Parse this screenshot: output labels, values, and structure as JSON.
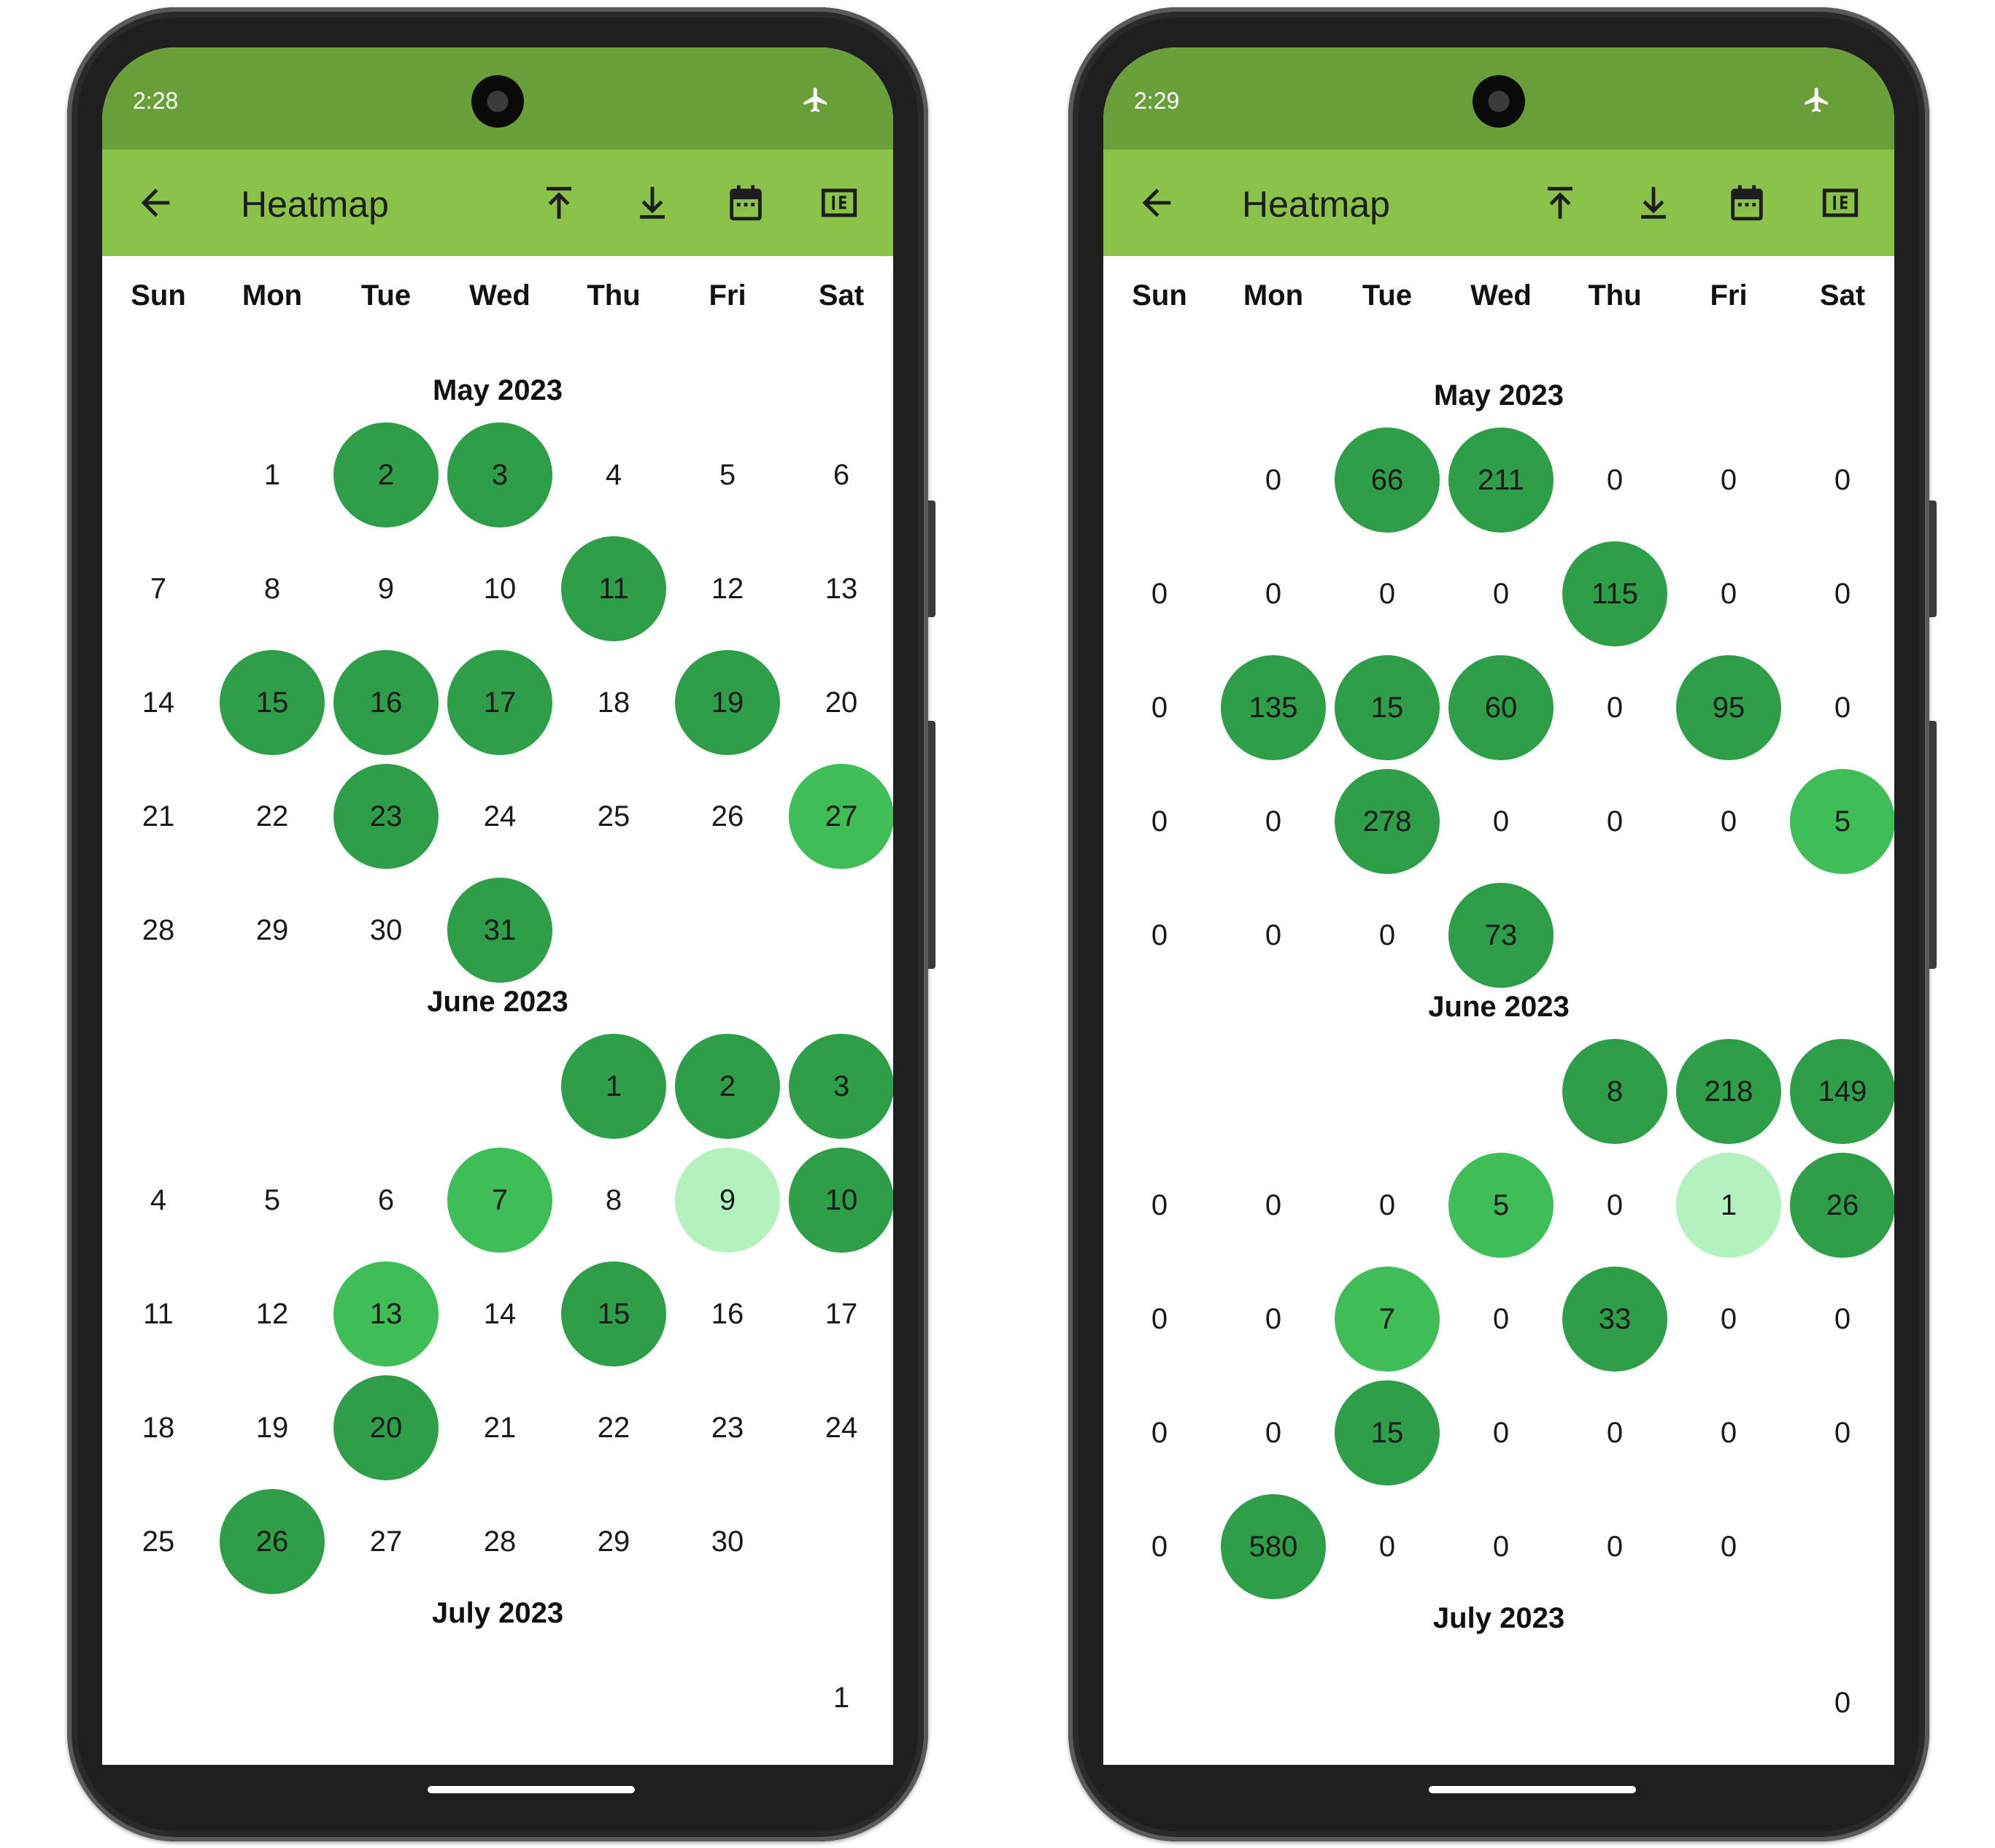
{
  "weekdays": [
    "Sun",
    "Mon",
    "Tue",
    "Wed",
    "Thu",
    "Fri",
    "Sat"
  ],
  "icons": {
    "plane": "airplane-mode-icon",
    "back": "arrow-back-icon",
    "scroll_top": "scroll-to-top-icon",
    "scroll_bottom": "scroll-to-bottom-icon",
    "calendar": "calendar-icon",
    "numbers": "show-numbers-icon"
  },
  "colors": {
    "status_bar": "#689f38",
    "toolbar": "#8bc34a",
    "level_high": "#2e9e48",
    "level_mid": "#3fbe58",
    "level_low": "#b3f2bf"
  },
  "screens": [
    {
      "status_time": "2:28",
      "title": "Heatmap",
      "months": [
        {
          "name": "May 2023",
          "start": 1,
          "labels": [
            "1",
            "2",
            "3",
            "4",
            "5",
            "6",
            "7",
            "8",
            "9",
            "10",
            "11",
            "12",
            "13",
            "14",
            "15",
            "16",
            "17",
            "18",
            "19",
            "20",
            "21",
            "22",
            "23",
            "24",
            "25",
            "26",
            "27",
            "28",
            "29",
            "30",
            "31"
          ],
          "levels": [
            0,
            3,
            3,
            0,
            0,
            0,
            0,
            0,
            0,
            0,
            3,
            0,
            0,
            0,
            3,
            3,
            3,
            0,
            3,
            0,
            0,
            0,
            3,
            0,
            0,
            0,
            2,
            0,
            0,
            0,
            3
          ]
        },
        {
          "name": "June 2023",
          "start": 4,
          "labels": [
            "1",
            "2",
            "3",
            "4",
            "5",
            "6",
            "7",
            "8",
            "9",
            "10",
            "11",
            "12",
            "13",
            "14",
            "15",
            "16",
            "17",
            "18",
            "19",
            "20",
            "21",
            "22",
            "23",
            "24",
            "25",
            "26",
            "27",
            "28",
            "29",
            "30"
          ],
          "levels": [
            3,
            3,
            3,
            0,
            0,
            0,
            2,
            0,
            1,
            3,
            0,
            0,
            2,
            0,
            3,
            0,
            0,
            0,
            0,
            3,
            0,
            0,
            0,
            0,
            0,
            3,
            0,
            0,
            0,
            0
          ]
        },
        {
          "name": "July 2023",
          "start": 6,
          "labels": [
            "1"
          ],
          "levels": [
            0
          ]
        }
      ]
    },
    {
      "status_time": "2:29",
      "title": "Heatmap",
      "months": [
        {
          "name": "May 2023",
          "start": 1,
          "labels": [
            "0",
            "66",
            "211",
            "0",
            "0",
            "0",
            "0",
            "0",
            "0",
            "0",
            "115",
            "0",
            "0",
            "0",
            "135",
            "15",
            "60",
            "0",
            "95",
            "0",
            "0",
            "0",
            "278",
            "0",
            "0",
            "0",
            "5",
            "0",
            "0",
            "0",
            "73"
          ],
          "levels": [
            0,
            3,
            3,
            0,
            0,
            0,
            0,
            0,
            0,
            0,
            3,
            0,
            0,
            0,
            3,
            3,
            3,
            0,
            3,
            0,
            0,
            0,
            3,
            0,
            0,
            0,
            2,
            0,
            0,
            0,
            3
          ]
        },
        {
          "name": "June 2023",
          "start": 4,
          "labels": [
            "8",
            "218",
            "149",
            "0",
            "0",
            "0",
            "5",
            "0",
            "1",
            "26",
            "0",
            "0",
            "7",
            "0",
            "33",
            "0",
            "0",
            "0",
            "0",
            "15",
            "0",
            "0",
            "0",
            "0",
            "0",
            "580",
            "0",
            "0",
            "0",
            "0"
          ],
          "levels": [
            3,
            3,
            3,
            0,
            0,
            0,
            2,
            0,
            1,
            3,
            0,
            0,
            2,
            0,
            3,
            0,
            0,
            0,
            0,
            3,
            0,
            0,
            0,
            0,
            0,
            3,
            0,
            0,
            0,
            0
          ]
        },
        {
          "name": "July 2023",
          "start": 6,
          "labels": [
            "0"
          ],
          "levels": [
            0
          ]
        }
      ]
    }
  ]
}
